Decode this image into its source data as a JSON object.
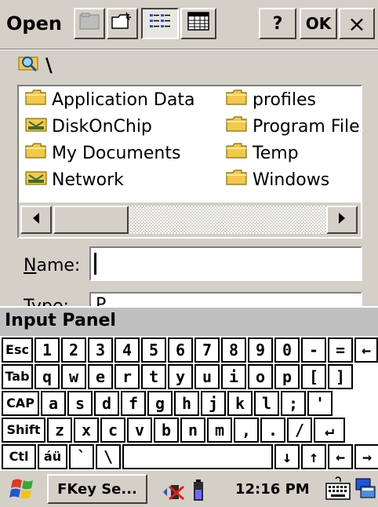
{
  "window": {
    "title": "Open",
    "ok_label": "OK",
    "help_label": "?",
    "close_label": "×"
  },
  "path": {
    "current": "\\"
  },
  "files": [
    {
      "name": "Application Data",
      "icon": "folder-icon"
    },
    {
      "name": "DiskOnChip",
      "icon": "storage-card-icon"
    },
    {
      "name": "My Documents",
      "icon": "folder-icon"
    },
    {
      "name": "Network",
      "icon": "storage-card-icon"
    },
    {
      "name": "profiles",
      "icon": "folder-icon"
    },
    {
      "name": "Program Files",
      "icon": "folder-icon"
    },
    {
      "name": "Temp",
      "icon": "folder-icon"
    },
    {
      "name": "Windows",
      "icon": "folder-icon"
    }
  ],
  "form": {
    "name_label": "Name:",
    "name_value": "",
    "type_label": "Type:",
    "type_value": "P"
  },
  "input_panel": {
    "title": "Input Panel",
    "rows": [
      [
        "Esc",
        "1",
        "2",
        "3",
        "4",
        "5",
        "6",
        "7",
        "8",
        "9",
        "0",
        "-",
        "=",
        "←"
      ],
      [
        "Tab",
        "q",
        "w",
        "e",
        "r",
        "t",
        "y",
        "u",
        "i",
        "o",
        "p",
        "[",
        "]"
      ],
      [
        "CAP",
        "a",
        "s",
        "d",
        "f",
        "g",
        "h",
        "j",
        "k",
        "l",
        ";",
        "'"
      ],
      [
        "Shift",
        "z",
        "x",
        "c",
        "v",
        "b",
        "n",
        "m",
        ",",
        ".",
        "/",
        "↵"
      ],
      [
        "Ctl",
        "áü",
        "`",
        "\\",
        "",
        "↓",
        "↑",
        "←",
        "→"
      ]
    ]
  },
  "taskbar": {
    "app_button": "FKey Se...",
    "time": "12:16 PM"
  },
  "colors": {
    "chrome": "#d4d0c8",
    "folder": "#f2c94c",
    "start_red": "#e03a1e",
    "start_green": "#3aa63a",
    "start_blue": "#2255d6",
    "start_yellow": "#f0c419"
  }
}
